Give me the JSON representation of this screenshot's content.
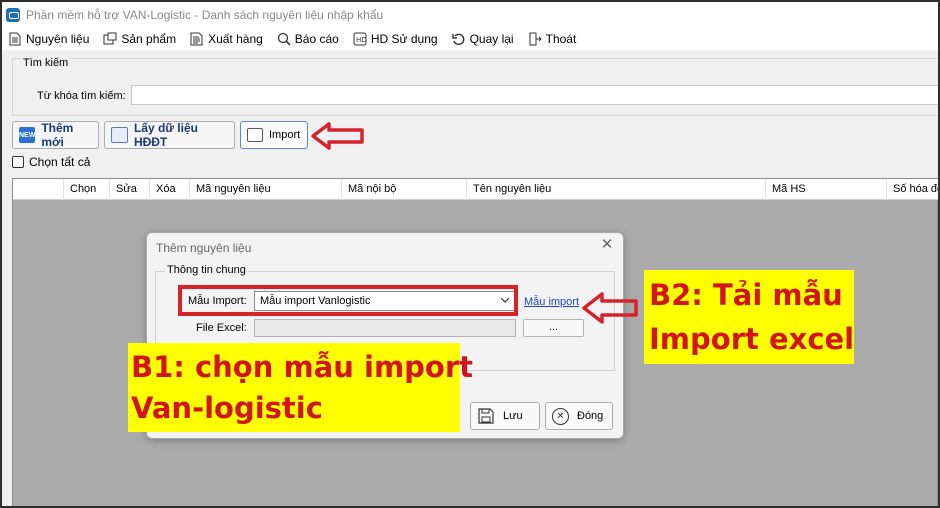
{
  "window": {
    "title": "Phần mềm hỗ trợ VAN-Logistic - Danh sách nguyên liệu nhập khẩu"
  },
  "menu": [
    {
      "label": "Nguyên liệu",
      "icon": "document-icon"
    },
    {
      "label": "Sản phẩm",
      "icon": "product-icon"
    },
    {
      "label": "Xuất hàng",
      "icon": "export-icon"
    },
    {
      "label": "Báo cáo",
      "icon": "report-icon"
    },
    {
      "label": "HD Sử dụng",
      "icon": "help-icon"
    },
    {
      "label": "Quay lại",
      "icon": "back-icon"
    },
    {
      "label": "Thoát",
      "icon": "exit-icon"
    }
  ],
  "search": {
    "group_label": "Tìm kiếm",
    "keyword_label": "Từ khóa tìm kiếm:",
    "keyword_value": ""
  },
  "toolbar": {
    "new_label": "Thêm mới",
    "new_icon_text": "NEW",
    "einvoice_label": "Lấy dữ liệu HĐĐT",
    "import_label": "Import"
  },
  "select_all_label": "Chọn tất cả",
  "grid": {
    "columns": [
      "Chọn",
      "Sửa",
      "Xóa",
      "Mã nguyên liệu",
      "Mã nội bộ",
      "Tên nguyên liệu",
      "Mã HS",
      "Số hóa đơn"
    ]
  },
  "dialog": {
    "title": "Thêm nguyên liệu",
    "close_glyph": "✕",
    "group_label": "Thông tin chung",
    "template_label": "Mẫu Import:",
    "template_value": "Mẫu import Vanlogistic",
    "template_link": "Mẫu import",
    "file_label": "File Excel:",
    "file_value": "",
    "browse_label": "...",
    "save_label": "Lưu",
    "close_label": "Đóng"
  },
  "annotations": {
    "step1_line1": "B1: chọn mẫu import",
    "step1_line2": "Van-logistic",
    "step2_line1": "B2: Tải mẫu",
    "step2_line2": "Import excel",
    "accent_red": "#d6232a",
    "highlight_yellow": "#ffff00"
  }
}
